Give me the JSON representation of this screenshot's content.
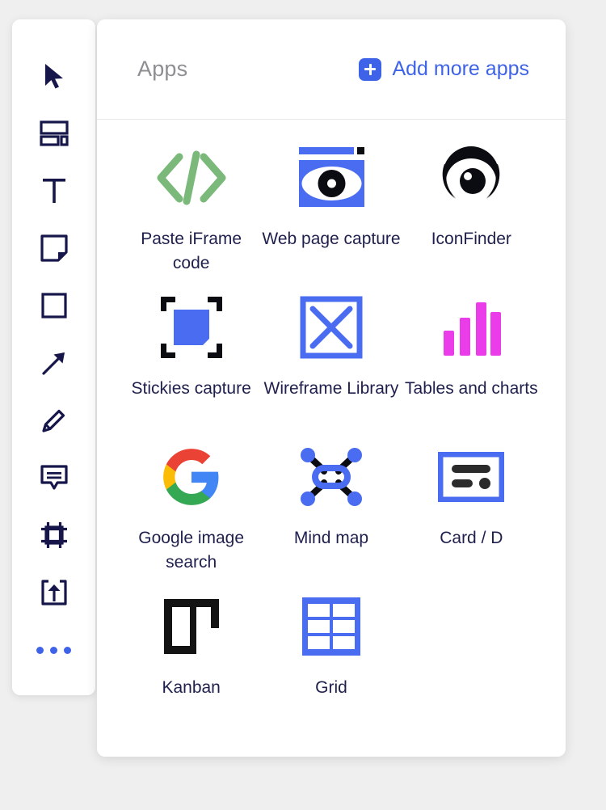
{
  "toolbar": {
    "items": [
      {
        "name": "select-tool",
        "icon": "cursor-icon"
      },
      {
        "name": "template-tool",
        "icon": "template-icon"
      },
      {
        "name": "text-tool",
        "icon": "text-icon"
      },
      {
        "name": "sticky-tool",
        "icon": "sticky-note-icon"
      },
      {
        "name": "shape-tool",
        "icon": "square-icon"
      },
      {
        "name": "arrow-tool",
        "icon": "arrow-icon"
      },
      {
        "name": "pen-tool",
        "icon": "pencil-icon"
      },
      {
        "name": "comment-tool",
        "icon": "comment-icon"
      },
      {
        "name": "frame-tool",
        "icon": "frame-icon"
      },
      {
        "name": "upload-tool",
        "icon": "upload-icon"
      },
      {
        "name": "more-tools",
        "icon": "ellipsis-icon"
      }
    ]
  },
  "panel": {
    "title": "Apps",
    "add_more_label": "Add more apps",
    "add_more_icon": "plus-icon"
  },
  "apps": [
    {
      "label": "Paste iFrame code",
      "icon": "code-brackets-icon",
      "color": "#7bb97a"
    },
    {
      "label": "Web page capture",
      "icon": "eye-browser-icon",
      "color": "#4a6cf0"
    },
    {
      "label": "IconFinder",
      "icon": "iconfinder-logo-icon",
      "color": "#0b0b12"
    },
    {
      "label": "Stickies capture",
      "icon": "capture-frame-icon",
      "color": "#4a6cf0"
    },
    {
      "label": "Wireframe Library",
      "icon": "x-box-icon",
      "color": "#4a6cf0"
    },
    {
      "label": "Tables and charts",
      "icon": "bar-chart-icon",
      "color": "#ea3ce8"
    },
    {
      "label": "Google image search",
      "icon": "google-logo-icon",
      "color": "#4285f4"
    },
    {
      "label": "Mind map",
      "icon": "mind-map-icon",
      "color": "#4a6cf0"
    },
    {
      "label": "Card / D",
      "icon": "card-icon",
      "color": "#4a6cf0"
    },
    {
      "label": "Kanban",
      "icon": "kanban-icon",
      "color": "#131313"
    },
    {
      "label": "Grid",
      "icon": "grid-icon",
      "color": "#4a6cf0"
    }
  ],
  "colors": {
    "accent": "#3f63e8",
    "title_gray": "#8f8f93",
    "label_navy": "#1f1f4d",
    "page_background": "#efefef"
  }
}
